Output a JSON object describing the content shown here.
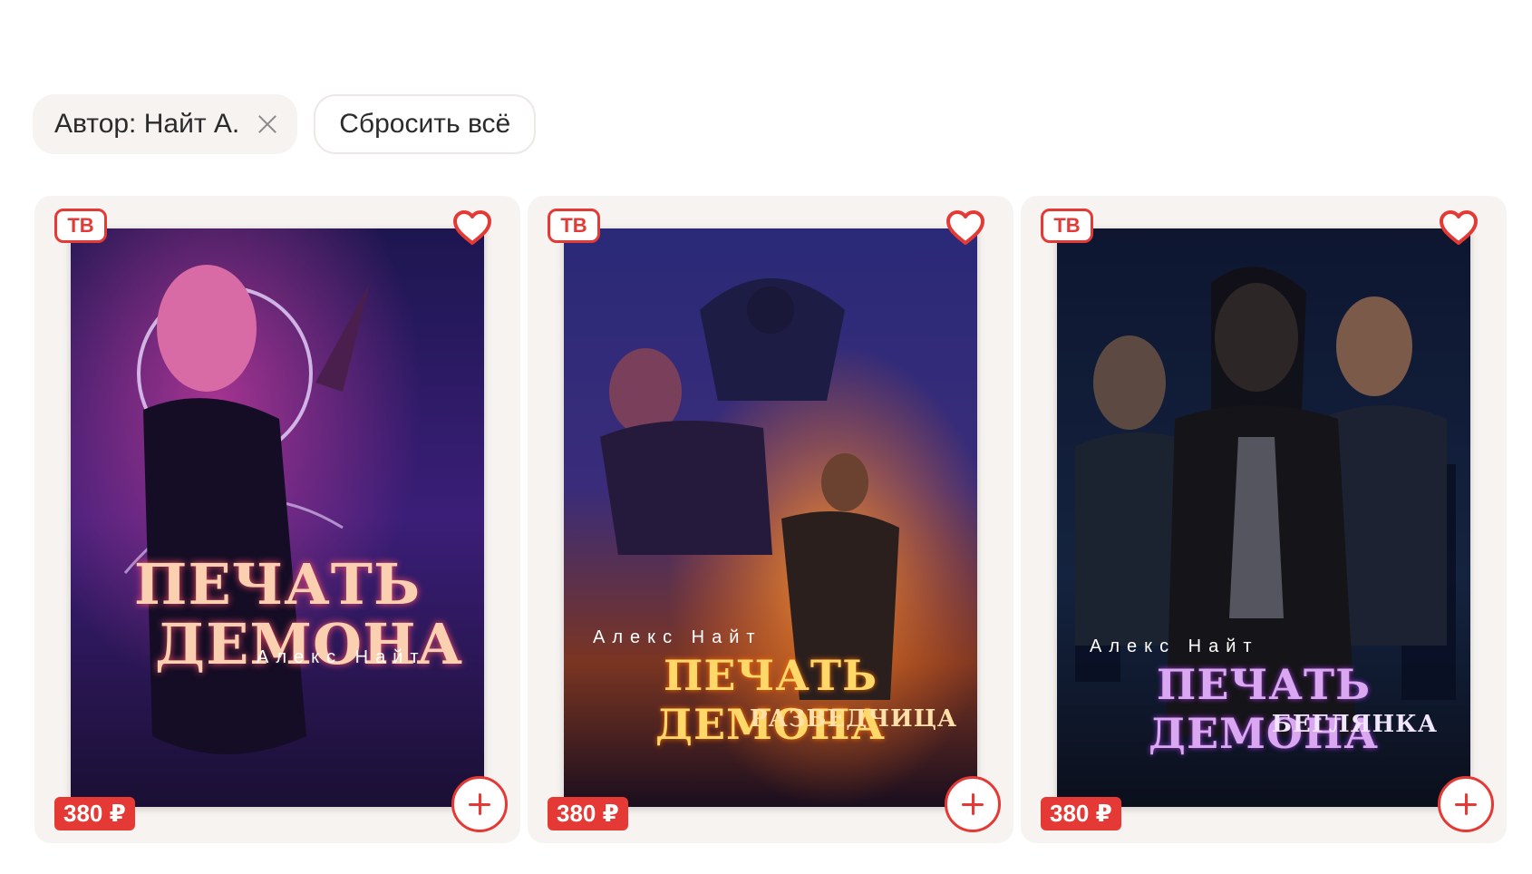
{
  "filters": {
    "author_chip": "Автор: Найт А.",
    "reset_label": "Сбросить всё"
  },
  "books": [
    {
      "badge": "ТВ",
      "price": "380 ₽",
      "cover_title_line1": "ПЕЧАТЬ",
      "cover_title_line2": "ДЕМОНА",
      "cover_author": "Алекс Найт",
      "cover_subtitle": ""
    },
    {
      "badge": "ТВ",
      "price": "380 ₽",
      "cover_title_line1": "ПЕЧАТЬ ДЕМОНА",
      "cover_title_line2": "",
      "cover_author": "Алекс Найт",
      "cover_subtitle": "РАЗВЕДЧИЦА"
    },
    {
      "badge": "ТВ",
      "price": "380 ₽",
      "cover_title_line1": "ПЕЧАТЬ ДЕМОНА",
      "cover_title_line2": "",
      "cover_author": "Алекс Найт",
      "cover_subtitle": "БЕГЛЯНКА"
    }
  ],
  "colors": {
    "accent": "#e53935",
    "card_bg": "#f7f3f1"
  },
  "icons": {
    "favorite": "heart-outline-icon",
    "add": "plus-circle-icon",
    "remove_filter": "close-icon"
  }
}
